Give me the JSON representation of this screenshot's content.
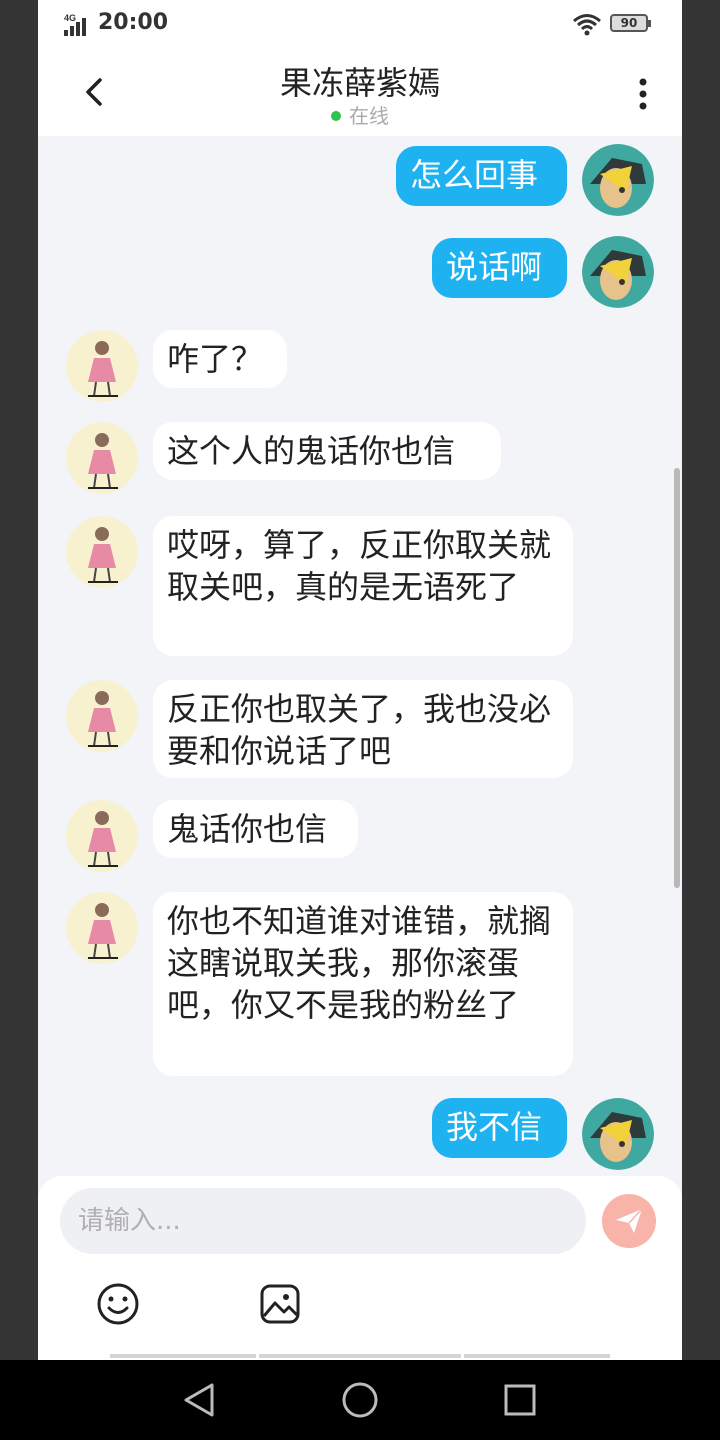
{
  "status_bar": {
    "network": "4G",
    "time": "20:00",
    "battery": "90"
  },
  "header": {
    "name": "果冻薛紫嫣",
    "status": "在线"
  },
  "messages": [
    {
      "sender": "me",
      "text": "怎么回事"
    },
    {
      "sender": "me",
      "text": "说话啊"
    },
    {
      "sender": "them",
      "text": "咋了？"
    },
    {
      "sender": "them",
      "text": "这个人的鬼话你也信"
    },
    {
      "sender": "them",
      "text": "哎呀，算了，反正你取关就取关吧，真的是无语死了"
    },
    {
      "sender": "them",
      "text": "反正你也取关了，我也没必要和你说话了吧"
    },
    {
      "sender": "them",
      "text": "鬼话你也信"
    },
    {
      "sender": "them",
      "text": "你也不知道谁对谁错，就搁这瞎说取关我，那你滚蛋吧，你又不是我的粉丝了"
    },
    {
      "sender": "me",
      "text": "我不信"
    }
  ],
  "input": {
    "placeholder": "请输入...",
    "value": ""
  },
  "colors": {
    "my_bubble": "#1fb2f0",
    "their_bubble": "#ffffff",
    "send_button": "#f8b4a9",
    "online_dot": "#2ec34e"
  },
  "icons": {
    "back": "chevron-left-icon",
    "more": "more-vertical-icon",
    "send": "paper-plane-icon",
    "emoji": "smiley-icon",
    "image": "image-icon"
  }
}
